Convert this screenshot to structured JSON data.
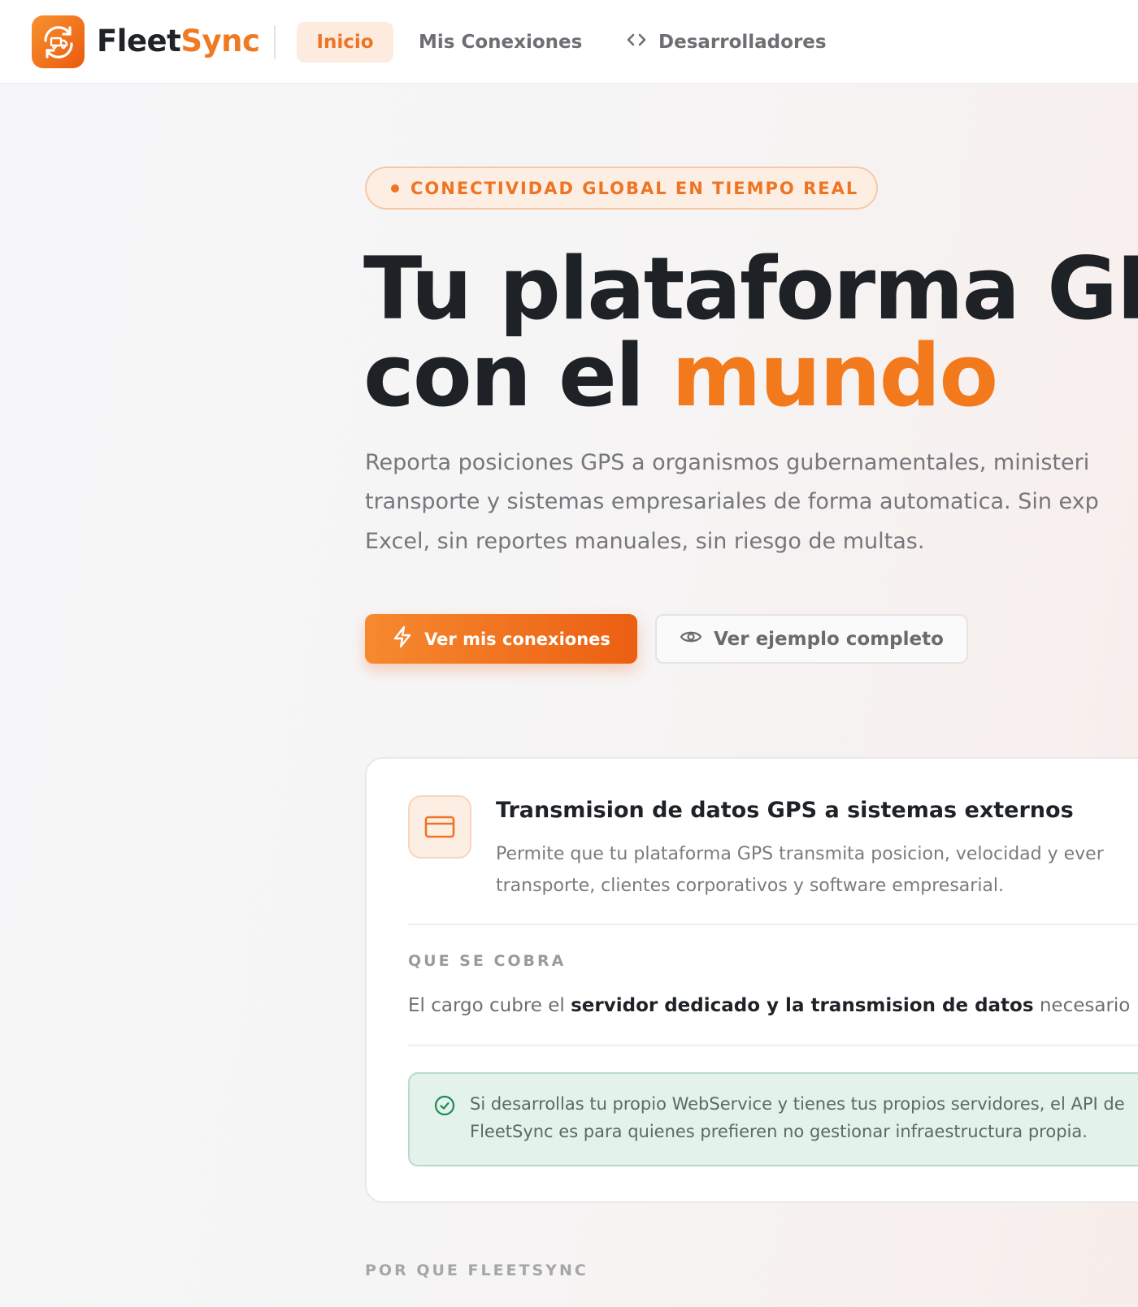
{
  "header": {
    "brand_part1": "Fleet",
    "brand_part2": "Sync",
    "nav": {
      "home": "Inicio",
      "connections": "Mis Conexiones",
      "developers": "Desarrolladores"
    }
  },
  "hero": {
    "badge": "CONECTIVIDAD GLOBAL EN TIEMPO REAL",
    "title_line1": "Tu plataforma GP",
    "title_line2_pre": "con el ",
    "title_line2_accent": "mundo",
    "lead": [
      "Reporta posiciones GPS a organismos gubernamentales, ministeri",
      "transporte y sistemas empresariales de forma automatica. Sin exp",
      "Excel, sin reportes manuales, sin riesgo de multas."
    ],
    "primary_button": "Ver mis conexiones",
    "secondary_button": "Ver ejemplo completo"
  },
  "card": {
    "title": "Transmision de datos GPS a sistemas externos",
    "desc": [
      "Permite que tu plataforma GPS transmita posicion, velocidad y ever",
      "transporte, clientes corporativos y software empresarial."
    ],
    "section_label": "QUE SE COBRA",
    "charge_pre": "El cargo cubre el ",
    "charge_bold": "servidor dedicado y la transmision de datos",
    "charge_post": " necesario",
    "note": [
      "Si desarrollas tu propio WebService y tienes tus propios servidores, el API de",
      "FleetSync es para quienes prefieren no gestionar infraestructura propia."
    ]
  },
  "section_why": "POR QUE FLEETSYNC",
  "colors": {
    "accent": "#f27a1d",
    "dark": "#1e2226",
    "success": "#1f8a55"
  },
  "icons": {
    "logo": "truck-sync-icon",
    "developers": "code-icon",
    "primary": "lightning-icon",
    "secondary": "eye-icon",
    "card": "credit-card-icon",
    "note": "check-circle-icon"
  }
}
